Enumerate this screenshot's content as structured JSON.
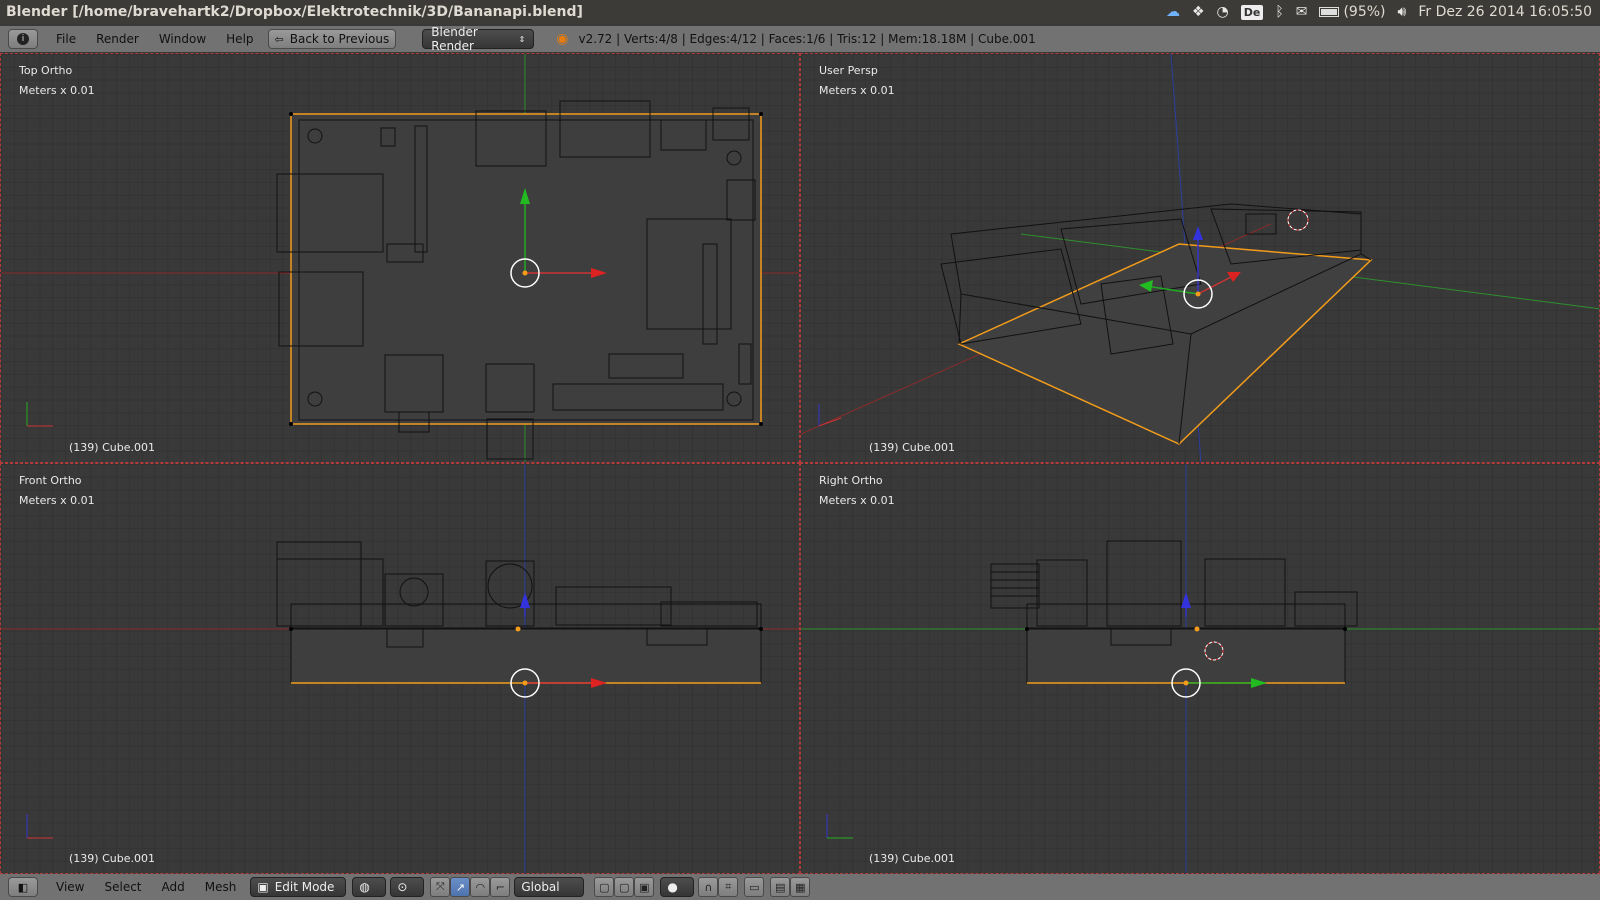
{
  "os_bar": {
    "title": "Blender [/home/bravehartk2/Dropbox/Elektrotechnik/3D/Bananapi.blend]",
    "keyboard_layout": "De",
    "battery": "(95%)",
    "clock": "Fr Dez 26 2014 16:05:50",
    "tray_icons": [
      "cloud-icon",
      "dropbox-icon",
      "wifi-icon",
      "keyboard-layout",
      "bluetooth-icon",
      "mail-icon",
      "battery-icon",
      "volume-icon"
    ]
  },
  "info_header": {
    "menus": [
      "File",
      "Render",
      "Window",
      "Help"
    ],
    "back_button": "Back to Previous",
    "render_engine": "Blender Render",
    "stats": "v2.72 | Verts:4/8 | Edges:4/12 | Faces:1/6 | Tris:12 | Mem:18.18M | Cube.001"
  },
  "viewports": [
    {
      "view": "Top Ortho",
      "scale": "Meters x 0.01",
      "object": "(139) Cube.001",
      "axis_v": "y",
      "axis_h": "x"
    },
    {
      "view": "User Persp",
      "scale": "Meters x 0.01",
      "object": "(139) Cube.001",
      "axis_v": "z",
      "axis_h": "x"
    },
    {
      "view": "Front Ortho",
      "scale": "Meters x 0.01",
      "object": "(139) Cube.001",
      "axis_v": "z",
      "axis_h": "x"
    },
    {
      "view": "Right Ortho",
      "scale": "Meters x 0.01",
      "object": "(139) Cube.001",
      "axis_v": "z",
      "axis_h": "y"
    }
  ],
  "bottom_header": {
    "menus": [
      "View",
      "Select",
      "Add",
      "Mesh"
    ],
    "mode": "Edit Mode",
    "orientation": "Global"
  },
  "colors": {
    "selection": "#f39c1b",
    "axis_x": "#c33",
    "axis_y": "#2a2",
    "axis_z": "#33c",
    "wire": "#000000",
    "header": "#727272"
  }
}
